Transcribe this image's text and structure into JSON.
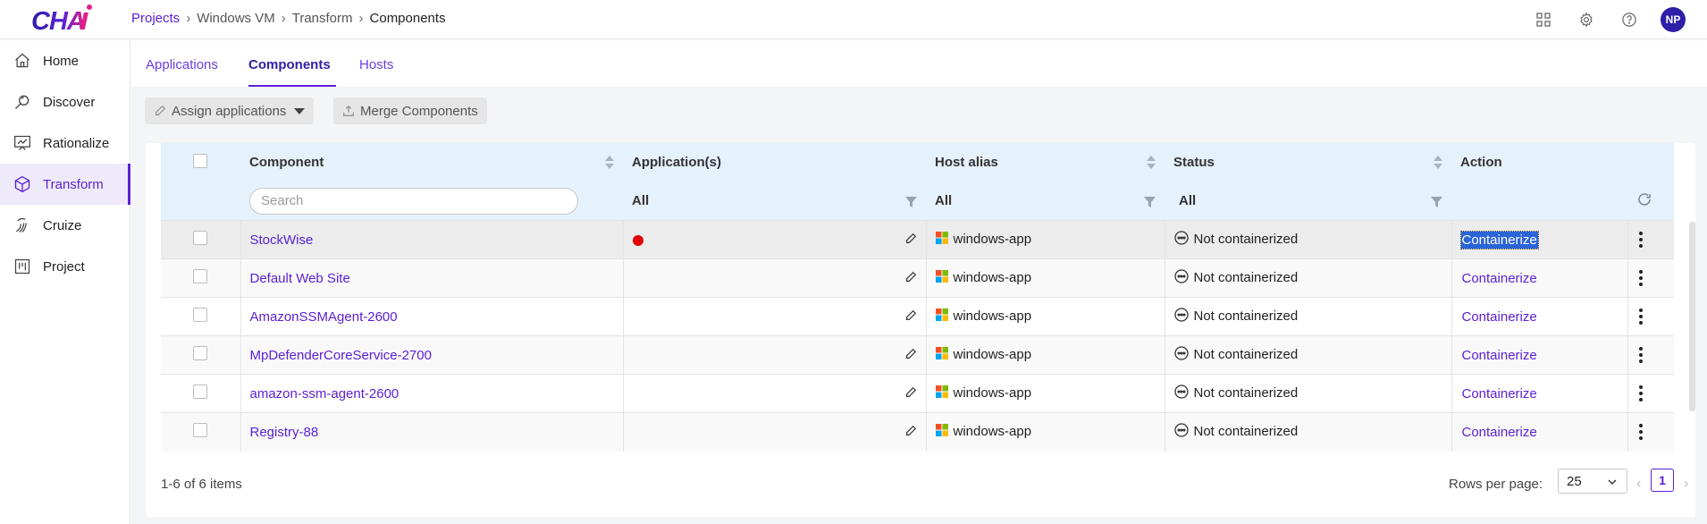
{
  "app": {
    "logo_text": "CHAI"
  },
  "breadcrumb": {
    "items": [
      "Projects",
      "Windows VM",
      "Transform",
      "Components"
    ]
  },
  "user": {
    "initials": "NP"
  },
  "sidebar": {
    "items": [
      {
        "label": "Home",
        "icon": "home-icon"
      },
      {
        "label": "Discover",
        "icon": "discover-icon"
      },
      {
        "label": "Rationalize",
        "icon": "rationalize-icon"
      },
      {
        "label": "Transform",
        "icon": "transform-icon",
        "active": true
      },
      {
        "label": "Cruize",
        "icon": "cruize-icon"
      },
      {
        "label": "Project",
        "icon": "project-icon"
      }
    ]
  },
  "tabs": [
    {
      "label": "Applications"
    },
    {
      "label": "Components",
      "active": true
    },
    {
      "label": "Hosts"
    }
  ],
  "toolbar": {
    "assign_label": "Assign applications",
    "merge_label": "Merge Components"
  },
  "table": {
    "headers": {
      "component": "Component",
      "applications": "Application(s)",
      "host_alias": "Host alias",
      "status": "Status",
      "action": "Action"
    },
    "filters": {
      "search_placeholder": "Search",
      "applications": "All",
      "host_alias": "All",
      "status": "All"
    },
    "rows": [
      {
        "component": "StockWise",
        "has_app_dot": true,
        "host": "windows-app",
        "status": "Not containerized",
        "action": "Containerize",
        "selected": true
      },
      {
        "component": "Default Web Site",
        "has_app_dot": false,
        "host": "windows-app",
        "status": "Not containerized",
        "action": "Containerize"
      },
      {
        "component": "AmazonSSMAgent-2600",
        "has_app_dot": false,
        "host": "windows-app",
        "status": "Not containerized",
        "action": "Containerize"
      },
      {
        "component": "MpDefenderCoreService-2700",
        "has_app_dot": false,
        "host": "windows-app",
        "status": "Not containerized",
        "action": "Containerize"
      },
      {
        "component": "amazon-ssm-agent-2600",
        "has_app_dot": false,
        "host": "windows-app",
        "status": "Not containerized",
        "action": "Containerize"
      },
      {
        "component": "Registry-88",
        "has_app_dot": false,
        "host": "windows-app",
        "status": "Not containerized",
        "action": "Containerize"
      }
    ]
  },
  "footer": {
    "count": "1-6 of 6 items",
    "rows_per_page_label": "Rows per page:",
    "rows_per_page_value": "25",
    "current_page": "1"
  },
  "colors": {
    "accent": "#5b21d4",
    "header_bg": "#e5f1fb",
    "status_dot": "#e00000",
    "selection": "#2b64d6"
  }
}
